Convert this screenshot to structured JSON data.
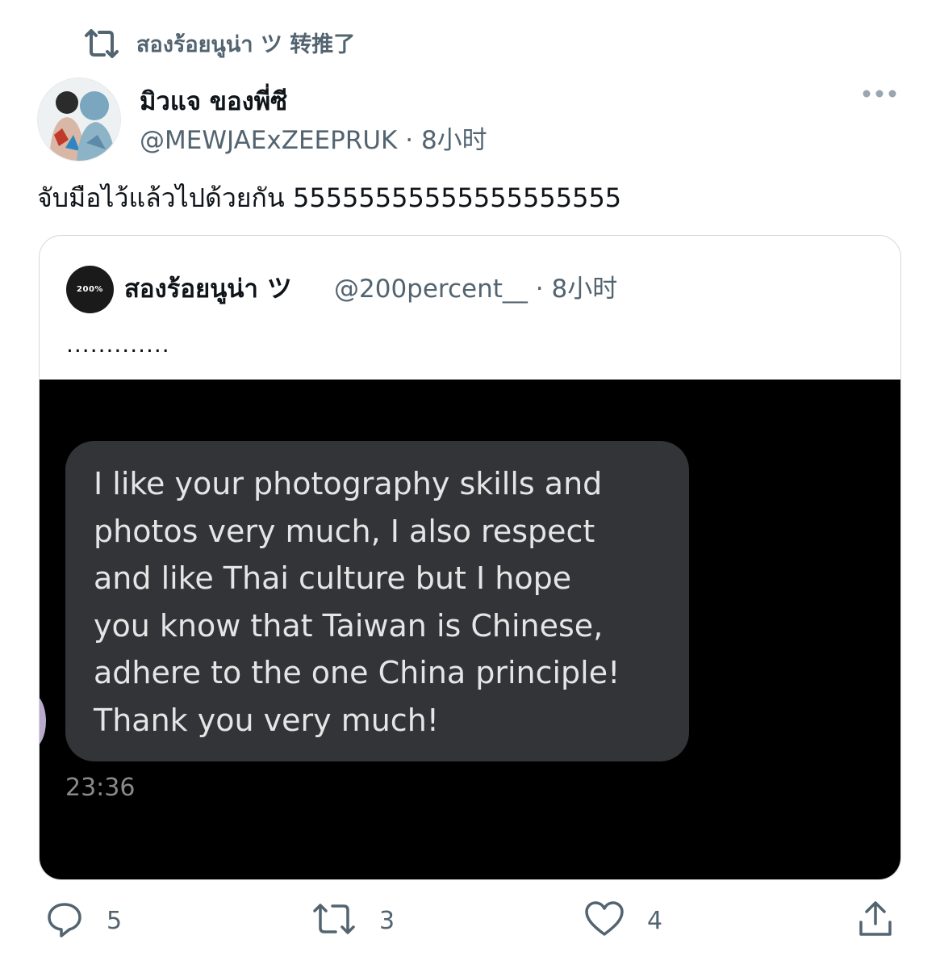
{
  "retweet_header": {
    "text": "สองร้อยนูน่า ツ 转推了",
    "icon": "retweet-icon"
  },
  "tweet": {
    "author_name": "มิวแจ ของพี่ซี",
    "author_handle": "@MEWJAExZEEPRUK",
    "time": "· 8小时",
    "text": "จับมือไว้แล้วไปด้วยกัน 55555555555555555555",
    "more_icon": "more-icon"
  },
  "quote": {
    "avatar_text": "200%",
    "author_name": "สองร้อยนูน่า ツ",
    "author_handle": "@200percent__",
    "time": "· 8小时",
    "text": ".............",
    "media": {
      "bubble_lines": [
        "I like your photography skills and",
        "photos very much, I also respect",
        "and like Thai culture but I hope",
        "you know that Taiwan is Chinese,",
        "adhere to the one China principle!",
        "Thank you very much!"
      ],
      "timestamp": "23:36"
    }
  },
  "actions": {
    "reply_count": "5",
    "retweet_count": "3",
    "like_count": "4",
    "icons": [
      "reply-icon",
      "retweet-icon",
      "like-icon",
      "share-icon"
    ]
  },
  "colors": {
    "text": "#0f1419",
    "secondary": "#536471",
    "border": "#cfd9de",
    "bubble": "#333438"
  }
}
